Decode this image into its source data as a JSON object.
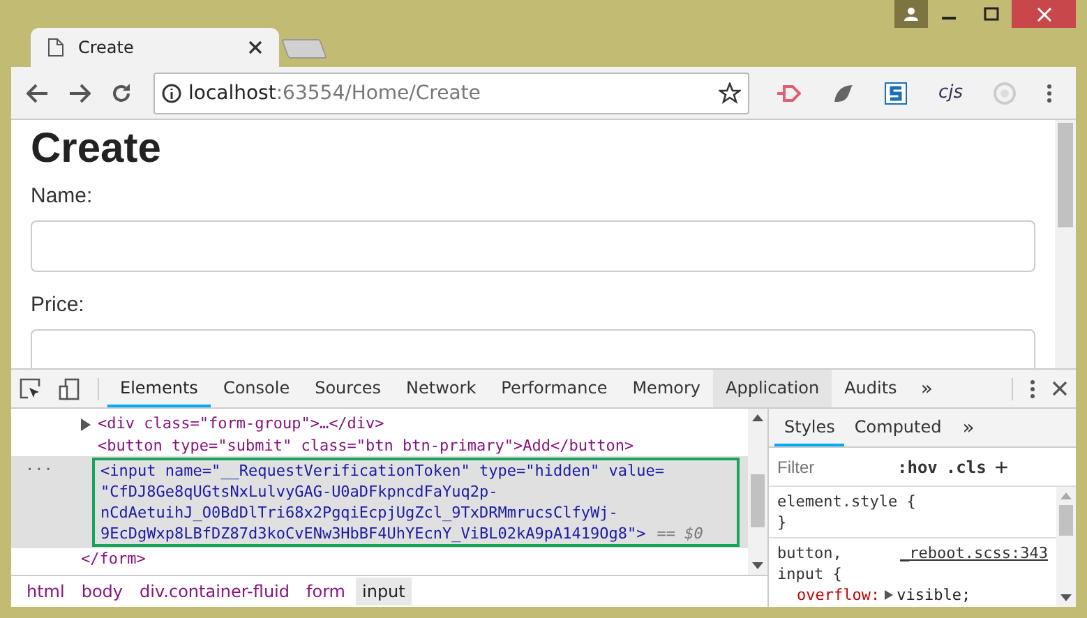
{
  "browser": {
    "tabs": [
      {
        "title": "Create",
        "selected": true
      },
      {
        "selected": false
      }
    ],
    "address": {
      "host": "localhost",
      "path": ":63554/Home/Create"
    },
    "cjs_label": "cjs"
  },
  "page": {
    "heading": "Create",
    "fields": [
      {
        "label": "Name:"
      },
      {
        "label": "Price:"
      }
    ]
  },
  "devtools": {
    "tabs": [
      {
        "label": "Elements",
        "selected": true,
        "hover": false
      },
      {
        "label": "Console",
        "selected": false,
        "hover": false
      },
      {
        "label": "Sources",
        "selected": false,
        "hover": false
      },
      {
        "label": "Network",
        "selected": false,
        "hover": false
      },
      {
        "label": "Performance",
        "selected": false,
        "hover": false
      },
      {
        "label": "Memory",
        "selected": false,
        "hover": false
      },
      {
        "label": "Application",
        "selected": false,
        "hover": true
      },
      {
        "label": "Audits",
        "selected": false,
        "hover": false
      }
    ],
    "more_tabs": "»",
    "dom_lines": [
      {
        "kind": "collapsed",
        "html": "<div class=\"form-group\">…</div>",
        "selected": false
      },
      {
        "kind": "plain",
        "html": "<button type=\"submit\" class=\"btn btn-primary\">Add</button>",
        "selected": false
      },
      {
        "kind": "token",
        "lines": [
          "<input name=\"__RequestVerificationToken\" type=\"hidden\" value=",
          "\"CfDJ8Ge8qUGtsNxLulvyGAG-U0aDFkpncdFaYuq2p-",
          "nCdAetuihJ_O0BdDlTri68x2PgqiEcpjUgZcl_9TxDRMmrucsClfyWj-",
          "9EcDgWxp8LBfDZ87d3koCvENw3HbBF4UhYEcnY_ViBL02kA9pA1419Og8\">"
        ],
        "suffix": "== $0",
        "dots": "...",
        "selected": true
      },
      {
        "kind": "close",
        "html": "</form>",
        "selected": false
      }
    ],
    "breadcrumbs": [
      {
        "label": "html",
        "selected": false
      },
      {
        "label": "body",
        "selected": false
      },
      {
        "label": "div.container-fluid",
        "selected": false
      },
      {
        "label": "form",
        "selected": false
      },
      {
        "label": "input",
        "selected": true
      }
    ],
    "styles": {
      "tabs": [
        {
          "label": "Styles",
          "selected": true
        },
        {
          "label": "Computed",
          "selected": false
        }
      ],
      "more_tabs": "»",
      "filter_placeholder": "Filter",
      "hov": ":hov",
      "cls": ".cls",
      "plus": "+",
      "rules": [
        {
          "selector": "element.style {",
          "close": "}"
        },
        {
          "selector": "button,",
          "source": "_reboot.scss:343",
          "selector2": "input {",
          "prop": "overflow:",
          "value": "visible;"
        }
      ]
    }
  }
}
